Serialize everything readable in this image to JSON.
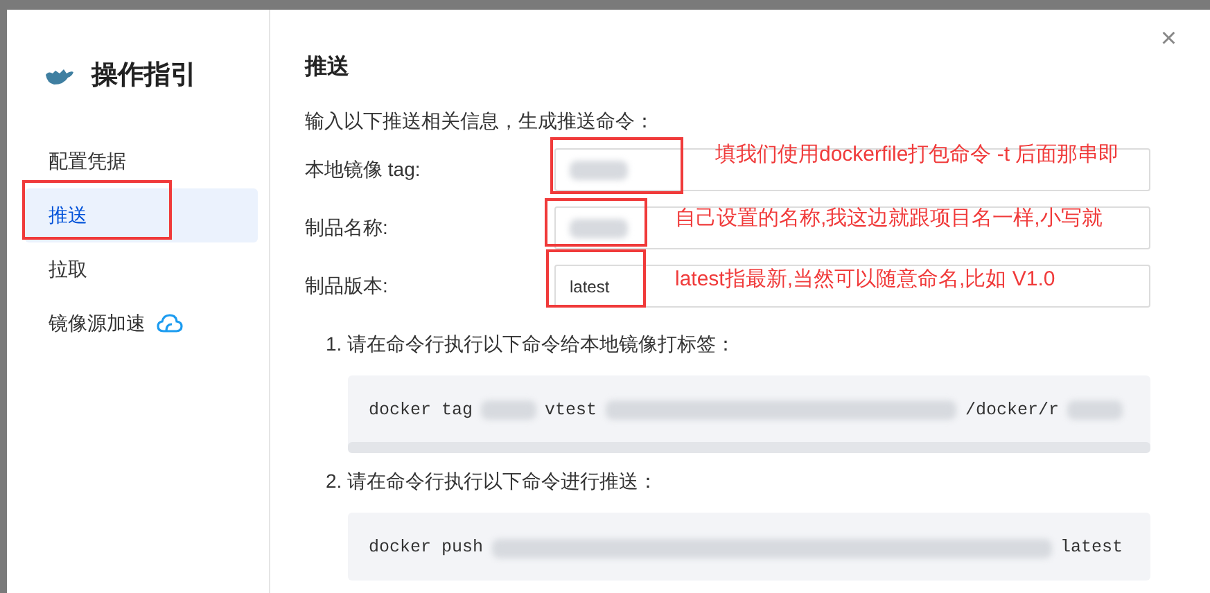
{
  "sidebar": {
    "title": "操作指引",
    "items": [
      {
        "label": "配置凭据",
        "selected": false,
        "kind": "plain"
      },
      {
        "label": "推送",
        "selected": true,
        "kind": "plain"
      },
      {
        "label": "拉取",
        "selected": false,
        "kind": "plain"
      },
      {
        "label": "镜像源加速",
        "selected": false,
        "kind": "cloud"
      }
    ]
  },
  "panel": {
    "title": "推送",
    "intro": "输入以下推送相关信息，生成推送命令：",
    "fields": [
      {
        "label": "本地镜像 tag:",
        "kind": "redacted"
      },
      {
        "label": "制品名称:",
        "kind": "redacted"
      },
      {
        "label": "制品版本:",
        "kind": "text",
        "value": "latest"
      }
    ],
    "steps": [
      {
        "text": "1. 请在命令行执行以下命令给本地镜像打标签：",
        "scrollbar": true,
        "command": [
          {
            "kind": "text",
            "text": "docker tag"
          },
          {
            "kind": "redacted"
          },
          {
            "kind": "text",
            "text": "vtest"
          },
          {
            "kind": "redacted"
          },
          {
            "kind": "text",
            "text": "/docker/r"
          },
          {
            "kind": "redacted"
          }
        ]
      },
      {
        "text": "2. 请在命令行执行以下命令进行推送：",
        "scrollbar": false,
        "command": [
          {
            "kind": "text",
            "text": "docker push"
          },
          {
            "kind": "redacted"
          },
          {
            "kind": "text",
            "text": "latest"
          }
        ]
      }
    ]
  },
  "annotations": [
    "填我们使用dockerfile打包命令 -t 后面那串即",
    "自己设置的名称,我这边就跟项目名一样,小写就",
    "latest指最新,当然可以随意命名,比如 V1.0"
  ],
  "close": "×"
}
